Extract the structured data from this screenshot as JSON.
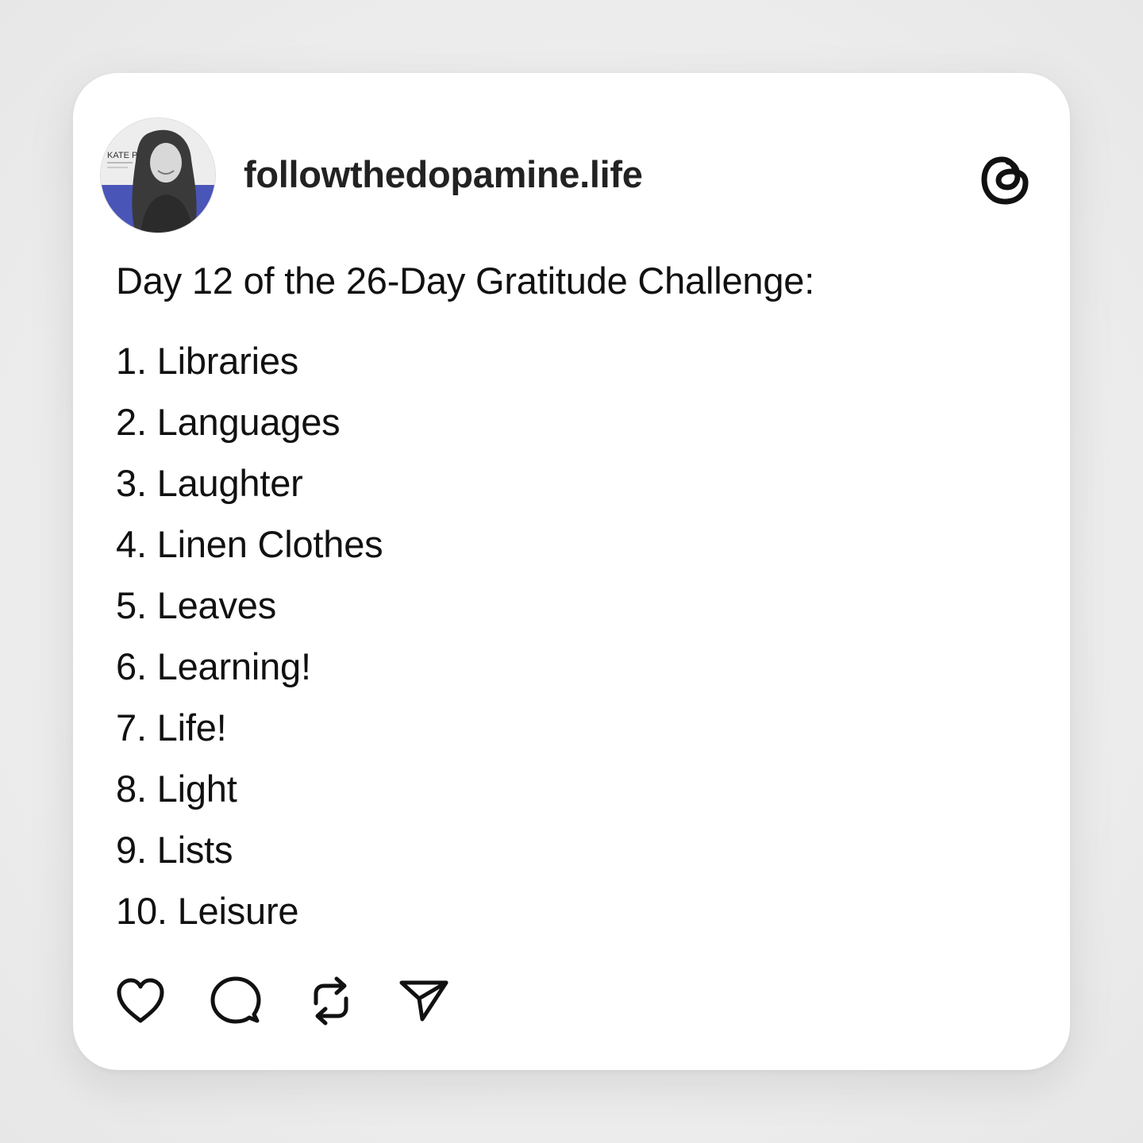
{
  "post": {
    "username": "followthedopamine.life",
    "avatar": {
      "badge_text": "KATE P.",
      "accent_color": "#4a55b8"
    },
    "title": "Day 12 of the 26-Day Gratitude Challenge:",
    "items": [
      "1. Libraries",
      "2. Languages",
      "3. Laughter",
      "4. Linen Clothes",
      "5. Leaves",
      "6. Learning!",
      "7. Life!",
      "8. Light",
      "9. Lists",
      "10. Leisure"
    ],
    "actions": [
      "heart-icon",
      "comment-icon",
      "repost-icon",
      "share-icon"
    ],
    "brand_icon": "threads-icon"
  }
}
